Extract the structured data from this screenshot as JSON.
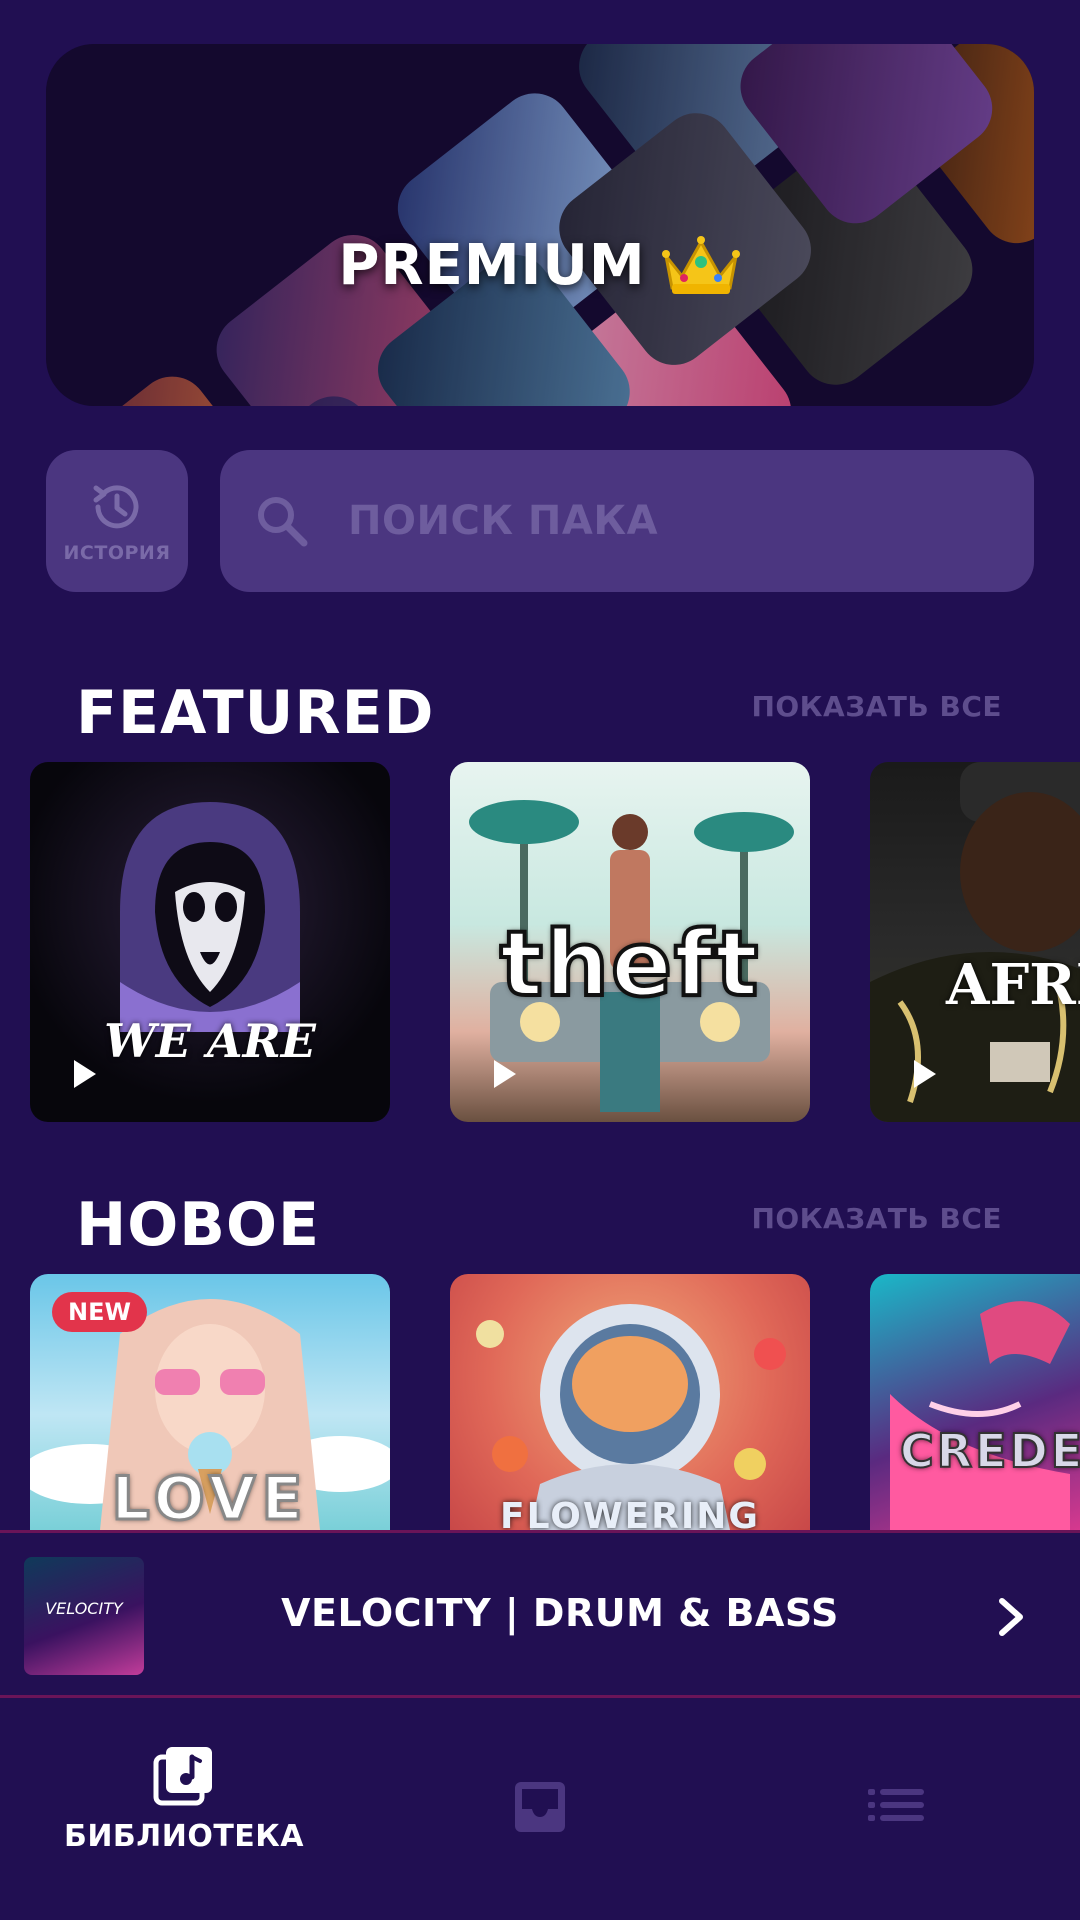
{
  "premium_banner": {
    "title": "PREMIUM",
    "crown_icon": "crown-icon"
  },
  "history": {
    "label": "ИСТОРИЯ",
    "icon": "history-icon"
  },
  "search": {
    "placeholder": "ПОИСК ПАКА",
    "icon": "search-icon"
  },
  "featured": {
    "title": "FEATURED",
    "show_all": "ПОКАЗАТЬ ВСЕ",
    "cards": [
      {
        "text": "WE ARE"
      },
      {
        "text": "theft"
      },
      {
        "text": "AFRIC"
      }
    ]
  },
  "new_section": {
    "title": "НОВОЕ",
    "show_all": "ПОКАЗАТЬ ВСЕ",
    "cards": [
      {
        "text": "LOVE",
        "badge": "NEW"
      },
      {
        "text": "FLOWERING"
      },
      {
        "text": "CREDE"
      }
    ]
  },
  "now_playing": {
    "thumb_text": "VELOCITY",
    "title": "VELOCITY | DRUM & BASS"
  },
  "bottom_nav": {
    "library_label": "БИБЛИОТЕКА"
  },
  "colors": {
    "background": "#210f52",
    "surface": "#4b3680",
    "muted_text": "#5e4d8d",
    "badge": "#e2344b",
    "divider": "#6a1458"
  }
}
